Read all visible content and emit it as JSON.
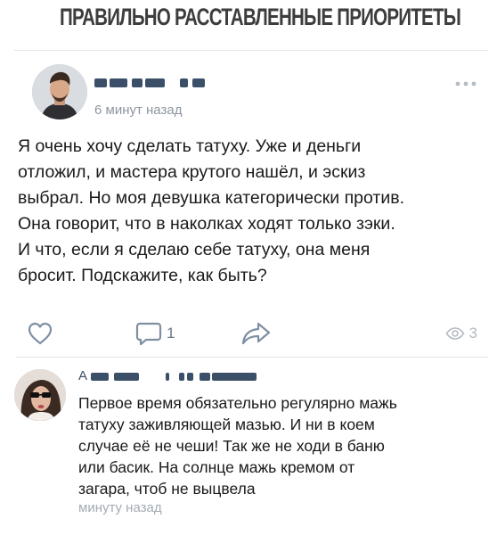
{
  "headline": "ПРАВИЛЬНО РАССТАВЛЕННЫЕ ПРИОРИТЕТЫ",
  "post": {
    "author": "",
    "time": "6 минут назад",
    "text": "Я очень хочу сделать татуху. Уже и деньги\nотложил, и мастера крутого нашёл, и эскиз\nвыбрал. Но моя девушка категорически против.\nОна говорит, что в наколках ходят только зэки.\nИ что, если я сделаю себе татуху, она меня\nбросит. Подскажите, как быть?",
    "actions": {
      "like_icon": "heart-outline-icon",
      "comment_icon": "comment-bubble-icon",
      "comment_count": "1",
      "share_icon": "share-arrow-icon",
      "views_icon": "eye-icon",
      "views_count": "3"
    },
    "more_icon": "more-dots-icon"
  },
  "comment": {
    "author_initial": "А",
    "text": "Первое время обязательно регулярно мажь\nтатуху заживляющей мазью. И ни в коем\nслучае её не чеши! Так же не ходи в баню\nили басик. На солнце мажь кремом от\nзагара, чтоб не выцвела",
    "time": "минуту назад"
  },
  "colors": {
    "accent_icon": "#7f8fa3",
    "muted_text": "#8d96a1",
    "name_link": "#3b5068"
  }
}
